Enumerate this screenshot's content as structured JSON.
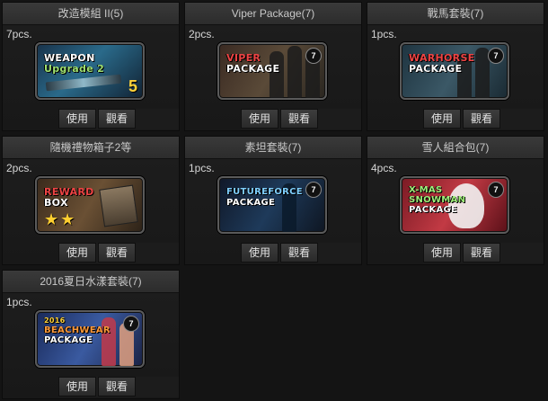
{
  "cards": [
    {
      "title": "改造模組 II(5)",
      "count": "7pcs.",
      "art": {
        "line1": "WEAPON",
        "line2": "Upgrade 2",
        "badge": "5"
      },
      "use_label": "使用",
      "view_label": "觀看"
    },
    {
      "title": "Viper Package(7)",
      "count": "2pcs.",
      "art": {
        "line1": "VIPER",
        "line2": "PACKAGE",
        "badge": "7"
      },
      "use_label": "使用",
      "view_label": "觀看"
    },
    {
      "title": "戰馬套裝(7)",
      "count": "1pcs.",
      "art": {
        "line1": "WARHORSE",
        "line2": "PACKAGE",
        "badge": "7"
      },
      "use_label": "使用",
      "view_label": "觀看"
    },
    {
      "title": "隨機禮物箱子2等",
      "count": "2pcs.",
      "art": {
        "line1": "REWARD",
        "line2": "BOX"
      },
      "use_label": "使用",
      "view_label": "觀看"
    },
    {
      "title": "素坦套裝(7)",
      "count": "1pcs.",
      "art": {
        "line1": "FUTUREFORCE",
        "line2": "PACKAGE",
        "badge": "7"
      },
      "use_label": "使用",
      "view_label": "觀看"
    },
    {
      "title": "雪人組合包(7)",
      "count": "4pcs.",
      "art": {
        "line1": "X-MAS",
        "line2": "SNOWMAN",
        "line3": "PACKAGE",
        "badge": "7"
      },
      "use_label": "使用",
      "view_label": "觀看"
    },
    {
      "title": "2016夏日水漾套裝(7)",
      "count": "1pcs.",
      "art": {
        "line0": "2016",
        "line1": "BEACHWEAR",
        "line2": "PACKAGE",
        "badge": "7"
      },
      "use_label": "使用",
      "view_label": "觀看"
    }
  ]
}
